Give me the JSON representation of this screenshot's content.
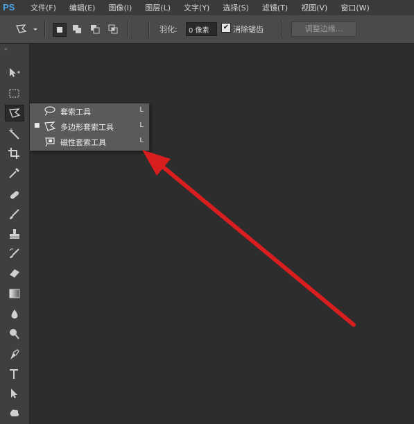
{
  "app": {
    "logo": "PS"
  },
  "menu": {
    "items": [
      {
        "label": "文件(F)"
      },
      {
        "label": "编辑(E)"
      },
      {
        "label": "图像(I)"
      },
      {
        "label": "图层(L)"
      },
      {
        "label": "文字(Y)"
      },
      {
        "label": "选择(S)"
      },
      {
        "label": "滤镜(T)"
      },
      {
        "label": "视图(V)"
      },
      {
        "label": "窗口(W)"
      }
    ]
  },
  "options": {
    "feather_label": "羽化:",
    "feather_value": "0 像素",
    "antialias_checked": true,
    "antialias_label": "消除锯齿",
    "refine_edge_label": "调整边缘..."
  },
  "toolbar": {
    "grip": "»",
    "tools": [
      "move-icon",
      "marquee-icon",
      "polygonal-lasso-icon",
      "magic-wand-icon",
      "crop-icon",
      "eyedropper-icon",
      "healing-brush-icon",
      "brush-icon",
      "clone-stamp-icon",
      "history-brush-icon",
      "eraser-icon",
      "gradient-icon",
      "blur-icon",
      "dodge-icon",
      "pen-icon",
      "type-icon",
      "path-selection-icon",
      "shape-icon"
    ],
    "active": "polygonal-lasso-icon"
  },
  "flyout": {
    "items": [
      {
        "label": "套索工具",
        "shortcut": "L",
        "selected": false,
        "icon": "lasso-icon"
      },
      {
        "label": "多边形套索工具",
        "shortcut": "L",
        "selected": true,
        "icon": "polygonal-lasso-icon"
      },
      {
        "label": "磁性套索工具",
        "shortcut": "L",
        "selected": false,
        "icon": "magnetic-lasso-icon"
      }
    ],
    "bullet": "■"
  },
  "colors": {
    "arrow": "#d81e1e",
    "canvas": "#2d2d2d",
    "menu_bg": "#3a3a3a",
    "options_bg": "#4a4a4a",
    "toolbar_bg": "#3f3f3f",
    "flyout_bg": "#5a5a5a"
  }
}
